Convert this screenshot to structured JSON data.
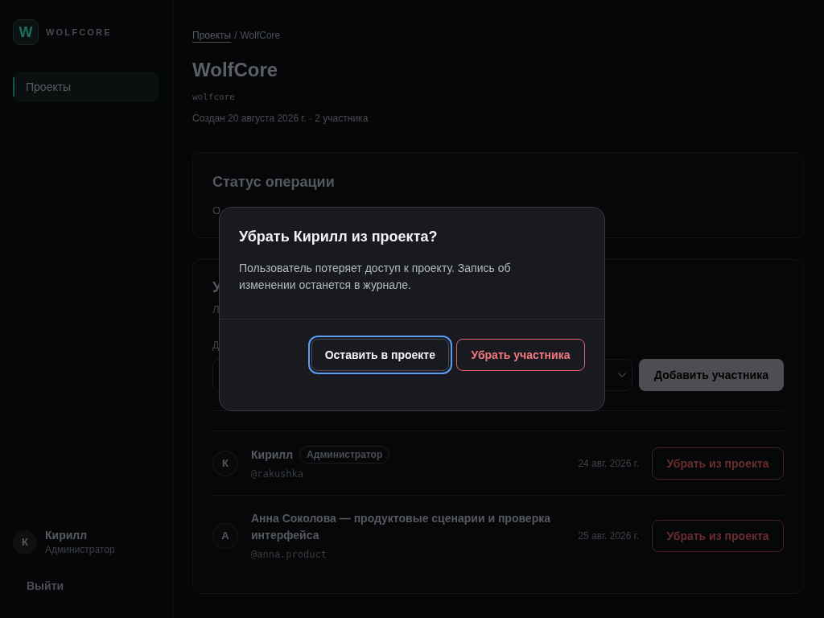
{
  "sidebar": {
    "logo": {
      "letter": "W",
      "name": "WOLFCORE"
    },
    "nav": [
      {
        "label": "Проекты",
        "selected": true
      }
    ],
    "user": {
      "initial": "К",
      "name": "Кирилл",
      "role": "Администратор"
    },
    "logout": "Выйти"
  },
  "breadcrumb": {
    "items": [
      {
        "label": "Проекты",
        "kind": "link"
      },
      {
        "label": "WolfCore",
        "kind": "current"
      }
    ],
    "separator": "/"
  },
  "project": {
    "title": "WolfCore",
    "slug": "wolfcore",
    "meta": "Создан 20 августа 2026 г. · 2 участника"
  },
  "status_card": {
    "title": "Статус операции",
    "text": "О"
  },
  "members_card": {
    "title": "У",
    "subtitle": "Л",
    "field_label": "Д",
    "add_button": {
      "label": "Добавить участника",
      "disabled": true
    },
    "members": [
      {
        "initial": "К",
        "name": "Кирилл",
        "badge": "Администратор",
        "handle": "@rakushka",
        "date": "24 авг. 2026 г.",
        "action": "Убрать из проекта"
      },
      {
        "initial": "А",
        "name": "Анна Соколова — продуктовые сценарии и проверка интерфейса",
        "handle": "@anna.product",
        "date": "25 авг. 2026 г.",
        "action": "Убрать из проекта"
      }
    ]
  },
  "dialog": {
    "title": "Убрать Кирилл из проекта?",
    "body": "Пользователь потеряет доступ к проекту. Запись об изменении останется в журнале.",
    "buttons": [
      {
        "label": "Оставить в проекте",
        "kind": "secondary",
        "focused": true
      },
      {
        "label": "Убрать участника",
        "kind": "danger",
        "focused": false
      }
    ]
  }
}
